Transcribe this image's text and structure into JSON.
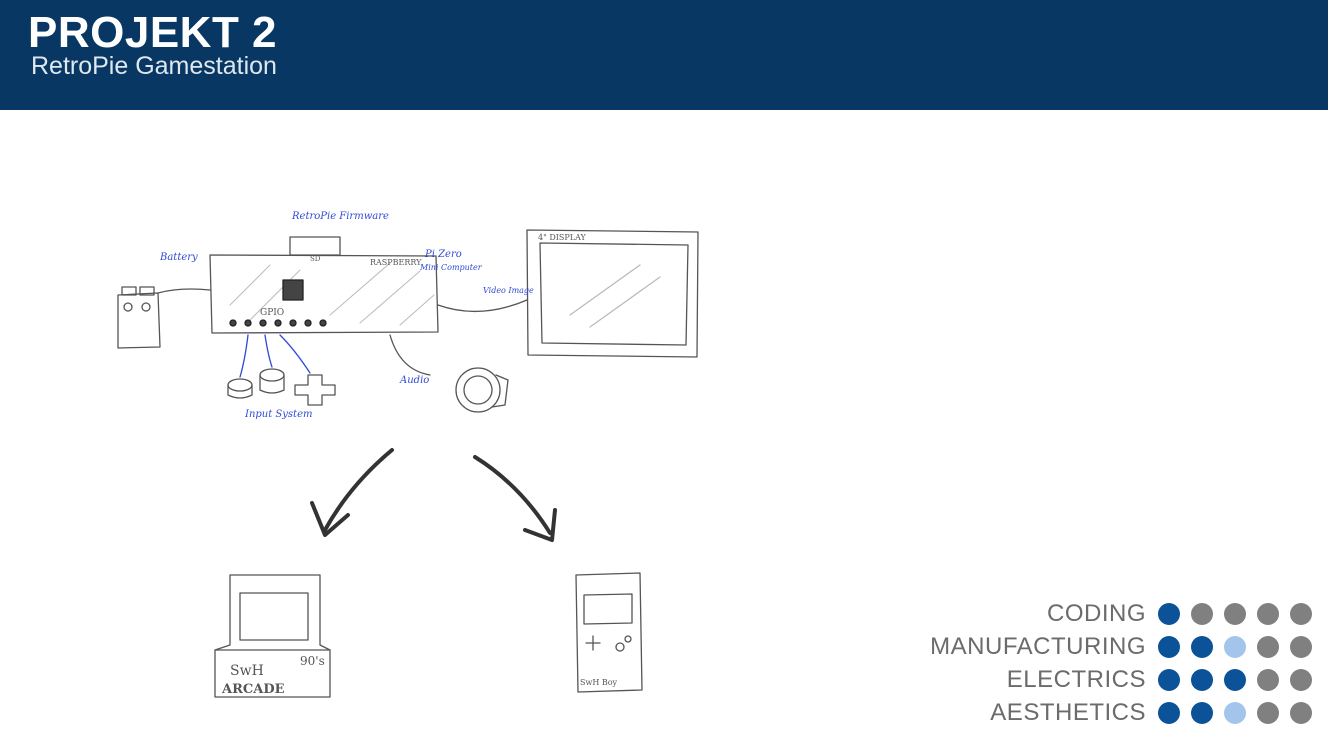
{
  "header": {
    "title": "PROJEKT 2",
    "subtitle": "RetroPie Gamestation"
  },
  "sketch": {
    "labels": {
      "firmware": "RetroPie Firmware",
      "sd": "SD",
      "raspberry": "RASPBERRY",
      "pi_zero": "Pi Zero",
      "mini_computer": "Mini Computer",
      "battery": "Battery",
      "gpio": "GPIO",
      "input_system": "Input System",
      "audio": "Audio",
      "video_image": "Video Image",
      "display": "4\" DISPLAY",
      "arcade_brand": "SwH",
      "arcade": "ARCADE",
      "arcade_era": "90's",
      "handheld": "SwH Boy"
    }
  },
  "colors": {
    "header_bg": "#083764",
    "dot_full": "#0b5299",
    "dot_half": "#a3c5ec",
    "dot_empty": "#808080"
  },
  "skills": [
    {
      "label": "CODING",
      "levels": [
        "full",
        "empty",
        "empty",
        "empty",
        "empty"
      ]
    },
    {
      "label": "MANUFACTURING",
      "levels": [
        "full",
        "full",
        "half",
        "empty",
        "empty"
      ]
    },
    {
      "label": "ELECTRICS",
      "levels": [
        "full",
        "full",
        "full",
        "empty",
        "empty"
      ]
    },
    {
      "label": "AESTHETICS",
      "levels": [
        "full",
        "full",
        "half",
        "empty",
        "empty"
      ]
    }
  ]
}
